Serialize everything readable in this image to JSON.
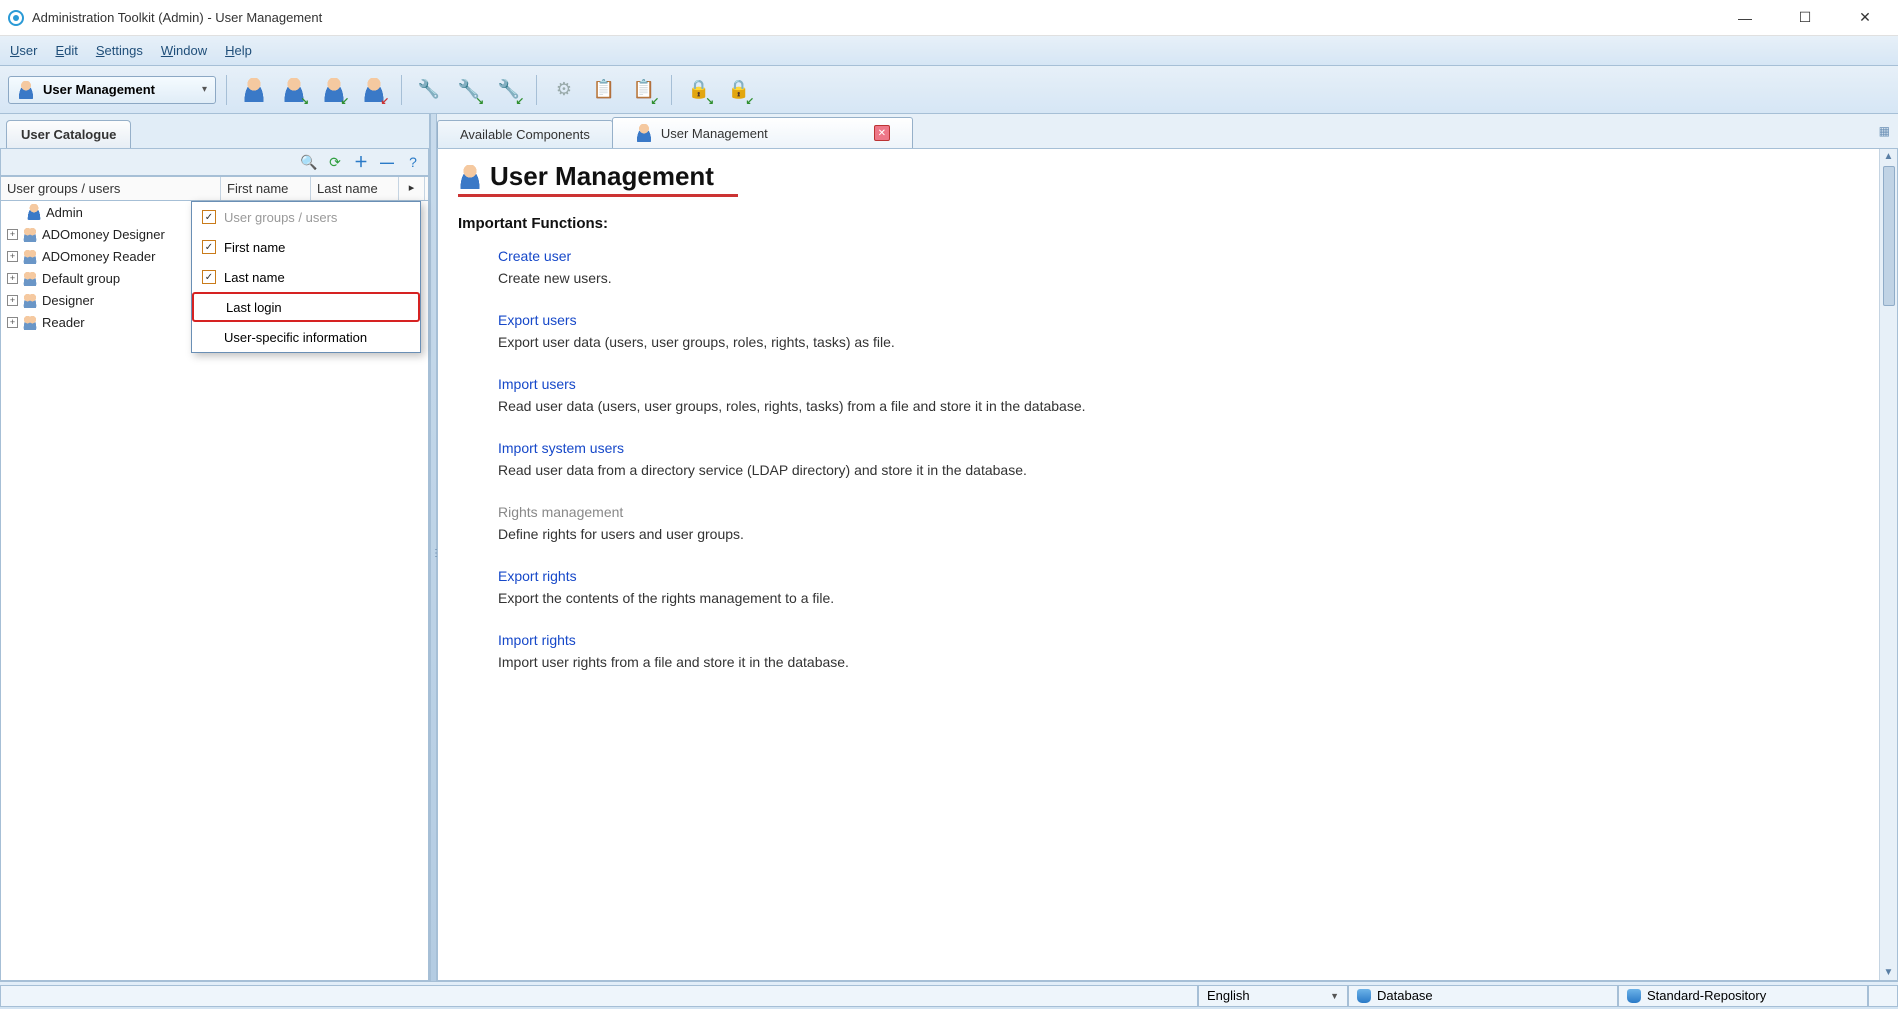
{
  "window": {
    "title": "Administration Toolkit (Admin) - User Management"
  },
  "menubar": {
    "items": [
      "User",
      "Edit",
      "Settings",
      "Window",
      "Help"
    ]
  },
  "toolbar": {
    "context_label": "User Management"
  },
  "left_panel": {
    "tab_label": "User Catalogue",
    "columns": {
      "c1": "User groups / users",
      "c2": "First name",
      "c3": "Last name"
    },
    "tree": [
      {
        "label": "Admin",
        "expandable": false
      },
      {
        "label": "ADOmoney Designer",
        "expandable": true
      },
      {
        "label": "ADOmoney Reader",
        "expandable": true
      },
      {
        "label": "Default group",
        "expandable": true
      },
      {
        "label": "Designer",
        "expandable": true
      },
      {
        "label": "Reader",
        "expandable": true
      }
    ],
    "popup": {
      "items": [
        {
          "label": "User groups / users",
          "checked": true,
          "disabled": true
        },
        {
          "label": "First name",
          "checked": true
        },
        {
          "label": "Last name",
          "checked": true
        },
        {
          "label": "Last login",
          "checked": false,
          "highlight": true
        },
        {
          "label": "User-specific information",
          "checked": false
        }
      ]
    }
  },
  "right_panel": {
    "tabs": [
      {
        "label": "Available Components",
        "active": false,
        "closable": false
      },
      {
        "label": "User Management",
        "active": true,
        "closable": true
      }
    ],
    "page_title": "User Management",
    "section_heading": "Important Functions:",
    "functions": [
      {
        "title": "Create user",
        "desc": "Create new users.",
        "enabled": true
      },
      {
        "title": "Export users",
        "desc": "Export user data (users, user groups, roles, rights, tasks) as file.",
        "enabled": true
      },
      {
        "title": "Import users",
        "desc": "Read user data (users, user groups, roles, rights, tasks) from a file and store it in the database.",
        "enabled": true
      },
      {
        "title": "Import system users",
        "desc": "Read user data from a directory service (LDAP directory) and store it in the database.",
        "enabled": true
      },
      {
        "title": "Rights management",
        "desc": "Define rights for users and user groups.",
        "enabled": false
      },
      {
        "title": "Export rights",
        "desc": "Export the contents of the rights management to a file.",
        "enabled": true
      },
      {
        "title": "Import rights",
        "desc": "Import user rights from a file and store it in the database.",
        "enabled": true
      }
    ]
  },
  "statusbar": {
    "language": "English",
    "database": "Database",
    "repository": "Standard-Repository"
  }
}
